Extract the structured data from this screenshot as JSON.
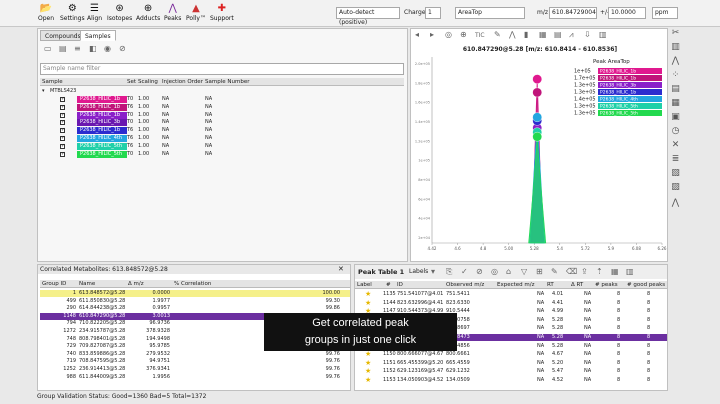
{
  "toolbar": {
    "buttons": [
      "Open",
      "Settings",
      "Align",
      "Isotopes",
      "Adducts",
      "Peaks",
      "Polly™",
      "Support"
    ],
    "detect_mode": "Auto-detect (positive)",
    "charge_label": "Charge",
    "charge_value": "1",
    "quant_type": "AreaTop",
    "mz_label": "m/z",
    "mz_value": "610.84729004",
    "tol_label": "+/-",
    "tol_value": "10.0000",
    "tol_unit": "ppm"
  },
  "left_panel": {
    "tabs": [
      "Compounds",
      "Samples"
    ],
    "filter_placeholder": "Sample name filter",
    "columns": [
      "Sample",
      "Set",
      "Scaling",
      "Injection Order",
      "Sample Number"
    ],
    "group_name": "MTBLS423",
    "samples": [
      {
        "name": "P2638_HILIC_1b",
        "set": "T0",
        "scaling": "1.00",
        "order": "NA",
        "number": "NA",
        "color": "#e0198f"
      },
      {
        "name": "P2638_HILIC_1b",
        "set": "T6",
        "scaling": "1.00",
        "order": "NA",
        "number": "NA",
        "color": "#c0147a"
      },
      {
        "name": "P2638_HILIC_1b",
        "set": "T0",
        "scaling": "1.00",
        "order": "NA",
        "number": "NA",
        "color": "#8a1fc9"
      },
      {
        "name": "P2638_HILIC_3b",
        "set": "T0",
        "scaling": "1.00",
        "order": "NA",
        "number": "NA",
        "color": "#6a18b0"
      },
      {
        "name": "P2638_HILIC_1b",
        "set": "T6",
        "scaling": "1.00",
        "order": "NA",
        "number": "NA",
        "color": "#2c2ccf"
      },
      {
        "name": "P2638_HILIC_4th",
        "set": "T6",
        "scaling": "1.00",
        "order": "NA",
        "number": "NA",
        "color": "#23a6e0"
      },
      {
        "name": "P2638_HILIC_5th",
        "set": "T6",
        "scaling": "1.00",
        "order": "NA",
        "number": "NA",
        "color": "#1fd0a8"
      },
      {
        "name": "P2638_HILIC_5th",
        "set": "T0",
        "scaling": "1.00",
        "order": "NA",
        "number": "NA",
        "color": "#22d94e"
      }
    ]
  },
  "chart": {
    "toolbar_tic": "TIC"
  },
  "chart_data": {
    "type": "line",
    "title": "610.847290@5.28 [m/z: 610.8414 - 610.8536]",
    "legend_title": "Peak AreaTop",
    "x_ticks": [
      "4.42",
      "4.6",
      "4.8",
      "5.00",
      "5.28",
      "5.4",
      "5.72",
      "5.9",
      "6.08",
      "6.26"
    ],
    "y_ticks": [
      "2.0e+05",
      "1.8e+05",
      "1.6e+05",
      "1.4e+05",
      "1.2e+05",
      "1e+05",
      "8e+04",
      "6e+04",
      "4e+04",
      "2e+04"
    ],
    "apex_rt": 5.28,
    "series": [
      {
        "name": "P2638_HILIC_1b",
        "value": "1e+05",
        "color": "#e0198f",
        "apex": 185000
      },
      {
        "name": "P2638_HILIC_1b",
        "value": "1.7e+05",
        "color": "#c0147a",
        "apex": 170000
      },
      {
        "name": "P2638_HILIC_3b",
        "value": "1.3e+05",
        "color": "#8a1fc9",
        "apex": 130000
      },
      {
        "name": "P2638_HILIC_1b",
        "value": "1.3e+05",
        "color": "#2c2ccf",
        "apex": 138000
      },
      {
        "name": "P2638_HILIC_4th",
        "value": "1.4e+05",
        "color": "#23a6e0",
        "apex": 142000
      },
      {
        "name": "P2638_HILIC_5th",
        "value": "1.3e+05",
        "color": "#1fd0a8",
        "apex": 125000
      },
      {
        "name": "P2638_HILIC_5th",
        "value": "1.3e+05",
        "color": "#22d94e",
        "apex": 120000
      }
    ],
    "xlim": [
      4.42,
      6.3
    ],
    "ylim": [
      0,
      210000
    ]
  },
  "corr_panel": {
    "title": "Correlated Metabolites: 613.848572@5.28",
    "columns": [
      "Group ID",
      "Name",
      "Δ m/z",
      "% Correlation"
    ],
    "rows": [
      {
        "id": "1",
        "name": "613.848572@5.28",
        "dmz": "0.0000",
        "corr": "100.00"
      },
      {
        "id": "499",
        "name": "611.850830@5.28",
        "dmz": "1.9977",
        "corr": "99.30"
      },
      {
        "id": "290",
        "name": "614.844238@5.28",
        "dmz": "0.9957",
        "corr": "99.86"
      },
      {
        "id": "1148",
        "name": "610.847290@5.28",
        "dmz": "3.0013",
        "corr": "99.76"
      },
      {
        "id": "794",
        "name": "710.822205@5.28",
        "dmz": "96.9736",
        "corr": "99.86"
      },
      {
        "id": "1272",
        "name": "234.915787@5.28",
        "dmz": "378.9328",
        "corr": "99.76"
      },
      {
        "id": "748",
        "name": "808.798401@5.28",
        "dmz": "194.9498",
        "corr": "99.76"
      },
      {
        "id": "729",
        "name": "709.827087@5.28",
        "dmz": "95.9785",
        "corr": "99.76"
      },
      {
        "id": "740",
        "name": "833.859886@5.28",
        "dmz": "279.9532",
        "corr": "99.76"
      },
      {
        "id": "719",
        "name": "708.847595@5.28",
        "dmz": "94.9751",
        "corr": "99.76"
      },
      {
        "id": "1252",
        "name": "236.914413@5.28",
        "dmz": "376.9341",
        "corr": "99.76"
      },
      {
        "id": "988",
        "name": "611.844009@5.28",
        "dmz": "1.9956",
        "corr": "99.76"
      }
    ]
  },
  "peak_panel": {
    "title": "Peak Table 1",
    "labels_label": "Labels",
    "columns": [
      "Label",
      "#",
      "ID",
      "Observed m/z",
      "Expected m/z",
      "RT",
      "Δ RT",
      "# peaks",
      "# good peaks"
    ],
    "rows": [
      {
        "num": "1135",
        "id": "751.541077@4.01",
        "obs": "751.5411",
        "exp": "NA",
        "rt": "4.01",
        "drt": "NA",
        "peaks": "8",
        "good": "8"
      },
      {
        "num": "1144",
        "id": "823.632996@4.41",
        "obs": "823.6330",
        "exp": "NA",
        "rt": "4.41",
        "drt": "NA",
        "peaks": "8",
        "good": "8"
      },
      {
        "num": "1147",
        "id": "910.544373@4.99",
        "obs": "910.5444",
        "exp": "NA",
        "rt": "4.99",
        "drt": "NA",
        "peaks": "8",
        "good": "8"
      },
      {
        "num": "1145",
        "id": "132.0758",
        "obs": "132.0758",
        "exp": "NA",
        "rt": "5.28",
        "drt": "NA",
        "peaks": "8",
        "good": "8"
      },
      {
        "num": "1146",
        "id": "334.8697",
        "obs": "334.8697",
        "exp": "NA",
        "rt": "5.28",
        "drt": "NA",
        "peaks": "8",
        "good": "8"
      },
      {
        "num": "1148",
        "id": "610.847290@5.28",
        "obs": "610.8473",
        "exp": "NA",
        "rt": "5.28",
        "drt": "NA",
        "peaks": "8",
        "good": "8"
      },
      {
        "num": "1149",
        "id": "566.4856",
        "obs": "566.4856",
        "exp": "NA",
        "rt": "5.28",
        "drt": "NA",
        "peaks": "8",
        "good": "8"
      },
      {
        "num": "1150",
        "id": "800.666077@4.67",
        "obs": "800.6661",
        "exp": "NA",
        "rt": "4.67",
        "drt": "NA",
        "peaks": "8",
        "good": "8"
      },
      {
        "num": "1151",
        "id": "665.455399@5.20",
        "obs": "665.4559",
        "exp": "NA",
        "rt": "5.20",
        "drt": "NA",
        "peaks": "8",
        "good": "8"
      },
      {
        "num": "1152",
        "id": "629.123169@5.47",
        "obs": "629.1232",
        "exp": "NA",
        "rt": "5.47",
        "drt": "NA",
        "peaks": "8",
        "good": "8"
      },
      {
        "num": "1153",
        "id": "134.050903@4.52",
        "obs": "134.0509",
        "exp": "NA",
        "rt": "4.52",
        "drt": "NA",
        "peaks": "8",
        "good": "8"
      }
    ]
  },
  "status": "Group Validation Status: Good=1360 Bad=5 Total=1372",
  "caption": {
    "line1": "Get correlated peak",
    "line2": "groups in just one click"
  }
}
